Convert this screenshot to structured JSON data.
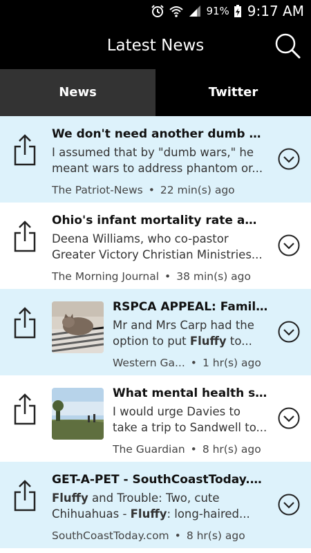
{
  "status_bar": {
    "icons": [
      "alarm-icon",
      "wifi-icon",
      "signal-icon",
      "battery-charging-icon"
    ],
    "battery": "91%",
    "time": "9:17 AM"
  },
  "app_bar": {
    "title": "Latest News",
    "search_icon": "search-icon"
  },
  "tabs": [
    {
      "label": "News",
      "selected": true
    },
    {
      "label": "Twitter",
      "selected": false
    }
  ],
  "articles": [
    {
      "headline": "We don't need another dumb war:...",
      "snippet_parts": [
        {
          "text": "I assumed that by \"dumb wars,\" he meant wars to address phantom or...",
          "bold": false
        }
      ],
      "source": "The Patriot-News",
      "time": "22 min(s) ago",
      "thumbnail": null,
      "background": "#ddf2fb"
    },
    {
      "headline": "Ohio's infant mortality rate among...",
      "snippet_parts": [
        {
          "text": "Deena Williams, who co-pastor Greater Victory Christian Ministries...",
          "bold": false
        }
      ],
      "source": "The Morning Journal",
      "time": "38 min(s) ago",
      "thumbnail": null,
      "background": "#ffffff"
    },
    {
      "headline": "RSPCA APPEAL: Family...",
      "snippet_parts": [
        {
          "text": "Mr and Mrs Carp had the option to put ",
          "bold": false
        },
        {
          "text": "Fluffy",
          "bold": true
        },
        {
          "text": " to...",
          "bold": false
        }
      ],
      "source": "Western Ga...",
      "time": "1 hr(s) ago",
      "thumbnail": "cat-photo",
      "background": "#ddf2fb"
    },
    {
      "headline": "What mental health serv...",
      "snippet_parts": [
        {
          "text": "I would urge Davies to take a trip to Sandwell to...",
          "bold": false
        }
      ],
      "source": "The Guardian",
      "time": "8 hr(s) ago",
      "thumbnail": "landscape-photo",
      "background": "#ffffff"
    },
    {
      "headline": "GET-A-PET - SouthCoastToday.com",
      "snippet_parts": [
        {
          "text": "Fluffy",
          "bold": true
        },
        {
          "text": " and Trouble: Two, cute Chihuahuas - ",
          "bold": false
        },
        {
          "text": "Fluffy",
          "bold": true
        },
        {
          "text": ": long-haired...",
          "bold": false
        }
      ],
      "source": "SouthCoastToday.com",
      "time": "8 hr(s) ago",
      "thumbnail": null,
      "background": "#ddf2fb"
    }
  ],
  "colors": {
    "bar": "#000000",
    "tab_selected": "#333333",
    "row_alt": "#ddf2fb",
    "icon": "#222222"
  }
}
